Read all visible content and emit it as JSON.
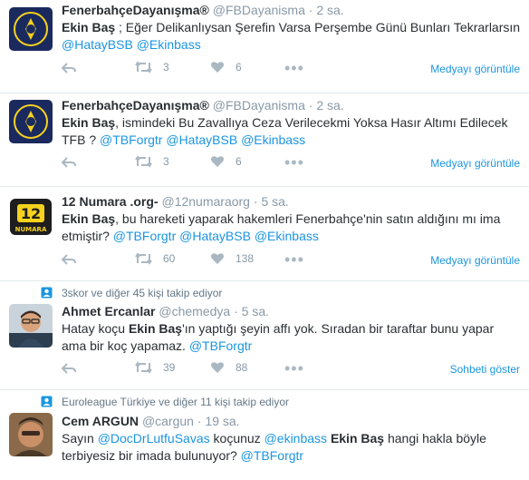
{
  "tweets": [
    {
      "name": "FenerbahçeDayanışma®",
      "handle": "@FBDayanisma",
      "dot": "·",
      "time": "2 sa.",
      "text_1": "Ekin Baş",
      "text_2": " ; Eğer Delikanlıysan Şerefin Varsa Perşembe Günü Bunları Tekrarlarsın ",
      "mention_1": "@HatayBSB",
      "space": " ",
      "mention_2": "@Ekinbass",
      "retweets": "3",
      "likes": "6",
      "right_link": "Medyayı görüntüle"
    },
    {
      "name": "FenerbahçeDayanışma®",
      "handle": "@FBDayanisma",
      "dot": "·",
      "time": "2 sa.",
      "text_1": "Ekin Baş",
      "text_2": ", ismindeki Bu Zavallıya Ceza Verilecekmi Yoksa Hasır Altımı Edilecek TFB ? ",
      "mention_1": "@TBForgtr",
      "mention_2": "@HatayBSB",
      "mention_3": "@Ekinbass",
      "retweets": "3",
      "likes": "6",
      "right_link": "Medyayı görüntüle"
    },
    {
      "name": "12 Numara .org-",
      "handle": "@12numaraorg",
      "dot": "·",
      "time": "5 sa.",
      "text_1": "Ekin Baş",
      "text_2": ", bu hareketi yaparak hakemleri Fenerbahçe'nin satın aldığını mı ima etmiştir? ",
      "mention_1": "@TBForgtr",
      "mention_2": "@HatayBSB",
      "mention_3": "@Ekinbass",
      "retweets": "60",
      "likes": "138",
      "right_link": "Medyayı görüntüle",
      "avatar_text": "12",
      "avatar_subtext": "NUMARA"
    },
    {
      "context": "3skor ve diğer 45 kişi takip ediyor",
      "name": "Ahmet Ercanlar",
      "handle": "@chemedya",
      "dot": "·",
      "time": "5 sa.",
      "text_1": "Hatay koçu ",
      "text_bold": "Ekin Baş",
      "text_2": "'ın yaptığı şeyin affı yok. Sıradan bir taraftar bunu yapar ama bir koç yapamaz. ",
      "mention_1": "@TBForgtr",
      "retweets": "39",
      "likes": "88",
      "right_link": "Sohbeti göster"
    },
    {
      "context": "Euroleague Türkiye ve diğer 11 kişi takip ediyor",
      "name": "Cem ARGUN",
      "handle": "@cargun",
      "dot": "·",
      "time": "19 sa.",
      "text_1": "Sayın ",
      "mention_1": "@DocDrLutfuSavas",
      "text_2": " koçunuz ",
      "mention_2": "@ekinbass",
      "text_bold": "Ekin Baş",
      "text_3": " hangi hakla böyle terbiyesiz bir imada bulunuyor? ",
      "mention_3": "@TBForgtr"
    }
  ],
  "colors": {
    "accent": "#1b95e0",
    "muted": "#8899a6",
    "divider": "#e1e8ed",
    "fb_navy": "#1b2a5e",
    "fb_yellow": "#f6d21e"
  }
}
